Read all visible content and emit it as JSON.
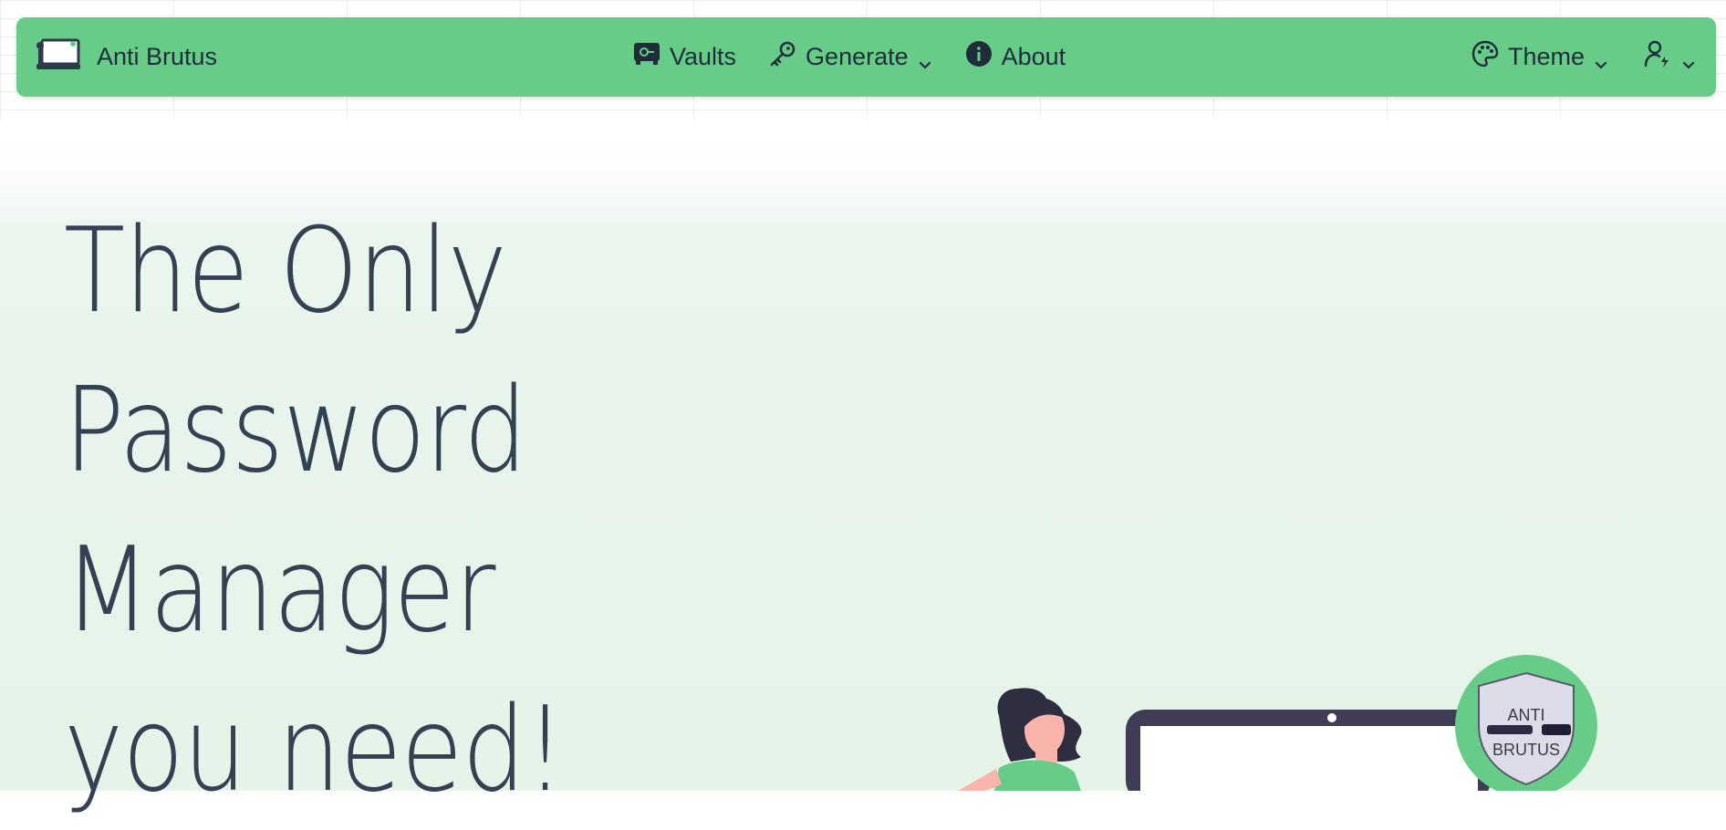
{
  "brand": {
    "name": "Anti Brutus"
  },
  "nav": {
    "vaults": "Vaults",
    "generate": "Generate",
    "about": "About",
    "theme": "Theme"
  },
  "hero": {
    "lines": [
      "The Only",
      "Password",
      "Manager",
      "you need!"
    ]
  },
  "badge": {
    "line1": "ANTI",
    "line2": "BRUTUS"
  },
  "colors": {
    "accent": "#66cc88",
    "text": "#354052",
    "dark": "#1f2d3a"
  },
  "icons": [
    "laptop-icon",
    "safe-icon",
    "key-icon",
    "info-icon",
    "palette-icon",
    "user-bolt-icon",
    "chevron-down-icon"
  ]
}
